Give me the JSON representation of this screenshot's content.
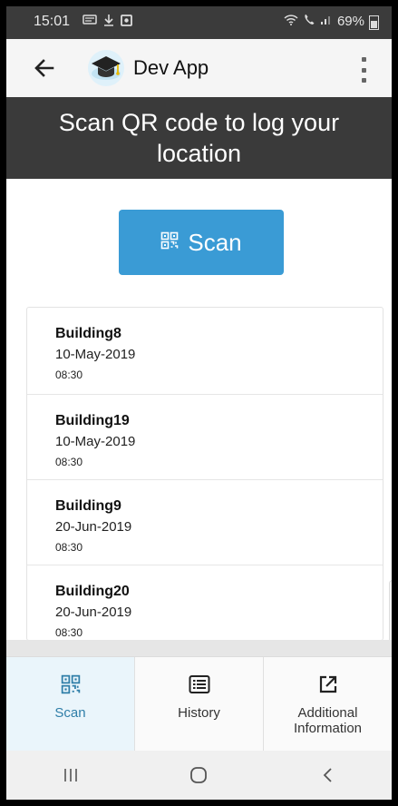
{
  "status_bar": {
    "time": "15:01",
    "battery": "69%"
  },
  "app_bar": {
    "title": "Dev App"
  },
  "banner": {
    "text": "Scan QR code to log your location"
  },
  "scan_button": {
    "label": "Scan",
    "color": "#3a9bd5"
  },
  "log_entries": [
    {
      "name": "Building8",
      "date": "10-May-2019",
      "time": "08:30"
    },
    {
      "name": "Building19",
      "date": "10-May-2019",
      "time": "08:30"
    },
    {
      "name": "Building9",
      "date": "20-Jun-2019",
      "time": "08:30"
    },
    {
      "name": "Building20",
      "date": "20-Jun-2019",
      "time": "08:30"
    }
  ],
  "bottom_nav": {
    "tabs": [
      {
        "label": "Scan",
        "icon": "qr-code-icon",
        "active": true
      },
      {
        "label": "History",
        "icon": "list-icon",
        "active": false
      },
      {
        "label": "Additional Information",
        "icon": "external-link-icon",
        "active": false
      }
    ],
    "active_color": "#2f7ea8"
  },
  "system_nav": {
    "buttons": [
      "recents-icon",
      "home-icon",
      "back-icon"
    ]
  }
}
